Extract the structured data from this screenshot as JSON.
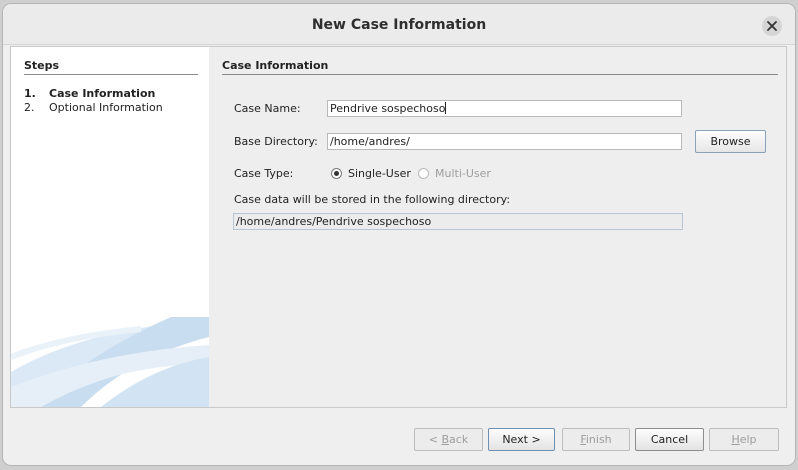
{
  "window": {
    "title": "New Case Information"
  },
  "steps": {
    "title": "Steps",
    "items": [
      {
        "num": "1.",
        "label": "Case Information",
        "active": true
      },
      {
        "num": "2.",
        "label": "Optional Information",
        "active": false
      }
    ]
  },
  "form": {
    "section_title": "Case Information",
    "case_name_label": "Case Name:",
    "case_name_value": "Pendrive sospechoso",
    "base_dir_label": "Base Directory:",
    "base_dir_value": "/home/andres/",
    "browse_label": "Browse",
    "case_type_label": "Case Type:",
    "case_type_options": [
      {
        "label": "Single-User",
        "selected": true,
        "enabled": true
      },
      {
        "label": "Multi-User",
        "selected": false,
        "enabled": false
      }
    ],
    "storage_note": "Case data will be stored in the following directory:",
    "storage_path": "/home/andres/Pendrive sospechoso"
  },
  "footer": {
    "back_prefix": "< ",
    "back_mnemonic": "B",
    "back_rest": "ack",
    "next_label": "Next >",
    "finish_mnemonic": "F",
    "finish_rest": "inish",
    "cancel_label": "Cancel",
    "help_mnemonic": "H",
    "help_rest": "elp"
  },
  "colors": {
    "window_bg": "#efefef",
    "panel_bg": "#ffffff",
    "accent_swoosh": "#b9d3ec"
  }
}
